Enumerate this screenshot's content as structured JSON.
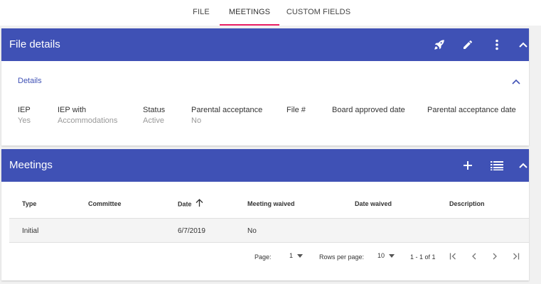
{
  "tabs": [
    {
      "label": "FILE",
      "active": false
    },
    {
      "label": "MEETINGS",
      "active": true
    },
    {
      "label": "CUSTOM FIELDS",
      "active": false
    }
  ],
  "file_details": {
    "title": "File details",
    "icons": [
      "rocket-icon",
      "pencil-icon",
      "more-vert-icon",
      "chevron-up-icon"
    ],
    "details_link": "Details",
    "fields": [
      {
        "label": "IEP",
        "value": "Yes"
      },
      {
        "label": "IEP with",
        "value": "Accommodations"
      },
      {
        "label": "Status",
        "value": "Active"
      },
      {
        "label": "Parental acceptance",
        "value": "No"
      },
      {
        "label": "File #",
        "value": ""
      },
      {
        "label": "Board approved date",
        "value": ""
      },
      {
        "label": "Parental acceptance date",
        "value": ""
      }
    ]
  },
  "meetings": {
    "title": "Meetings",
    "icons": [
      "plus-icon",
      "list-icon",
      "chevron-up-icon"
    ],
    "columns": [
      "Type",
      "Committee",
      "Date",
      "Meeting waived",
      "Date waived",
      "Description"
    ],
    "sort_column": "Date",
    "sort_direction": "ascending",
    "rows": [
      [
        "Initial",
        "",
        "6/7/2019",
        "No",
        "",
        ""
      ]
    ],
    "pager": {
      "page_label": "Page:",
      "page_value": "1",
      "rows_label": "Rows per page:",
      "rows_value": "10",
      "range": "1 - 1 of 1"
    }
  },
  "colors": {
    "header": "#3f51b5",
    "accent": "#e91e63",
    "link": "#3f51b5"
  }
}
